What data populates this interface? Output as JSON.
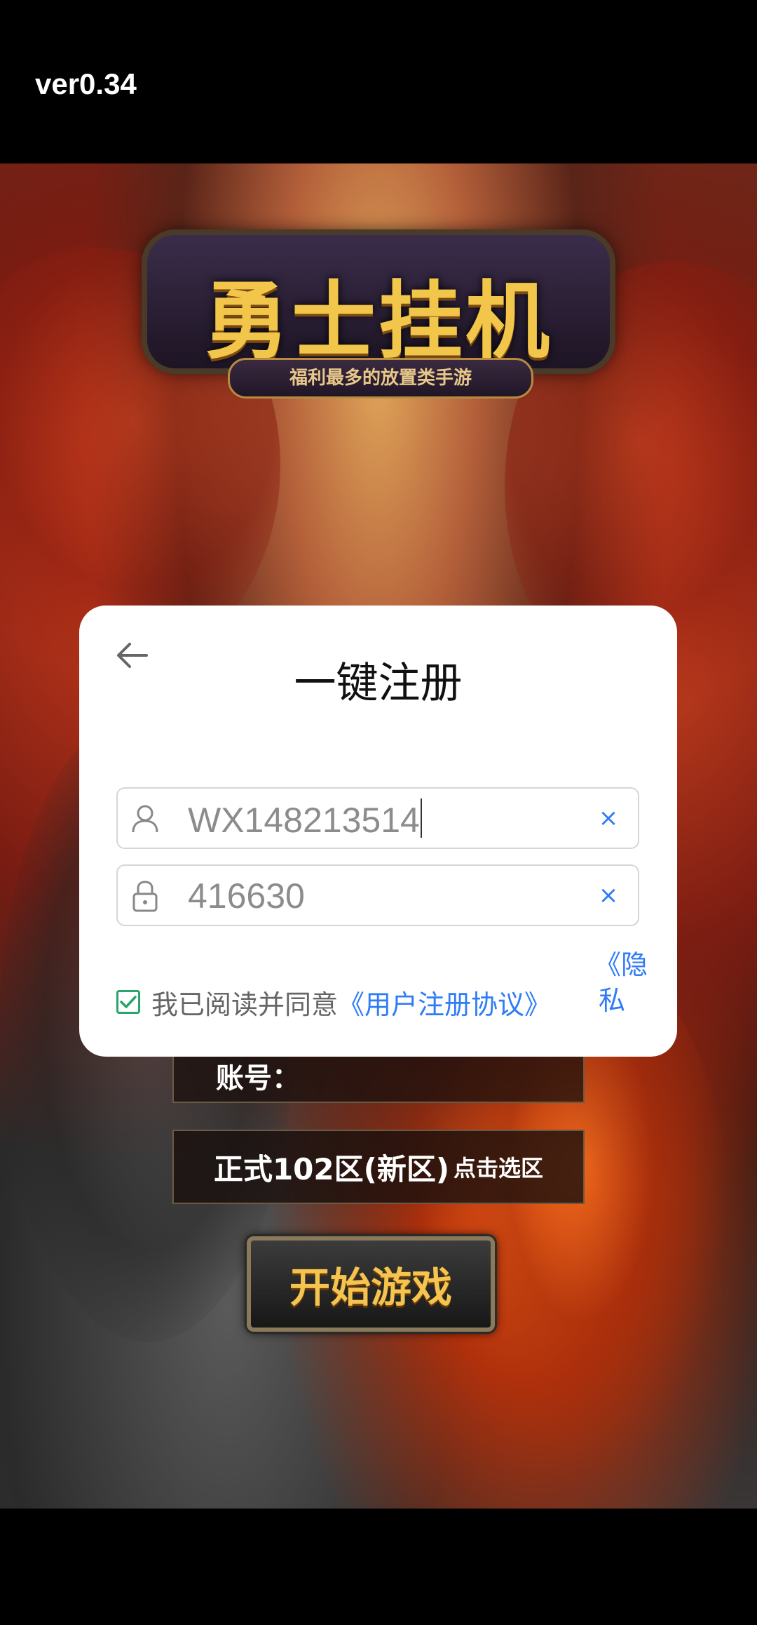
{
  "status": {
    "version": "ver0.34"
  },
  "game": {
    "logo_title": "勇士挂机",
    "logo_subtitle": "福利最多的放置类手游",
    "account_label": "账号：",
    "server_name": "正式102区(新区)",
    "server_hint": "点击选区",
    "start_label": "开始游戏"
  },
  "dialog": {
    "title": "一键注册",
    "account_value": "WX148213514",
    "password_value": "416630",
    "clear_symbol": "×",
    "agree_prefix": "我已阅读并同意",
    "agree_link": "《用户注册协议》",
    "privacy_link": "《隐私",
    "agree_checked": true,
    "colors": {
      "link": "#2f7cf6",
      "check": "#2ba36b"
    }
  },
  "icons": {
    "back": "arrow-left-icon",
    "user": "user-icon",
    "lock": "lock-icon",
    "check": "checkmark-icon"
  }
}
